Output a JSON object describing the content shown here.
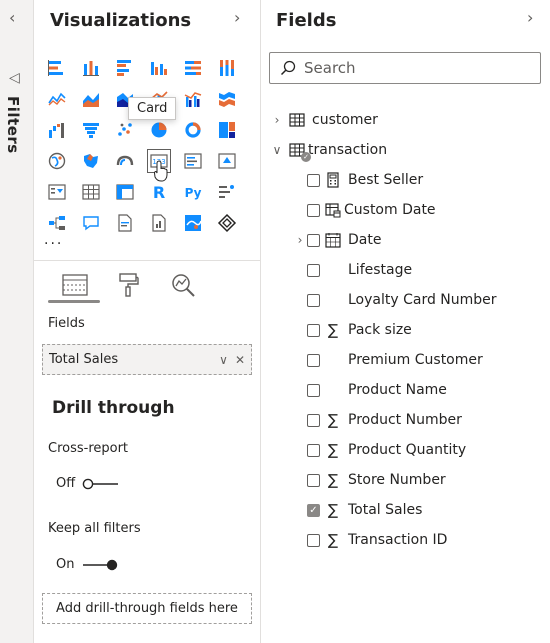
{
  "filters": {
    "label": "Filters",
    "collapse_icon": "chevron-left-icon",
    "icon": "funnel-icon"
  },
  "visualizations": {
    "title": "Visualizations",
    "expand_icon": "chevron-right-icon",
    "tooltip": "Card",
    "more": "...",
    "subtab_icons": [
      "build-visual-icon",
      "format-paintbrush-icon",
      "analytics-magnifier-icon"
    ],
    "fields_label": "Fields",
    "well_field": "Total Sales",
    "drill_title": "Drill through",
    "cross_report_label": "Cross-report",
    "cross_report_state": "Off",
    "keep_filters_label": "Keep all filters",
    "keep_filters_state": "On",
    "add_drill_label": "Add drill-through fields here"
  },
  "fields_pane": {
    "title": "Fields",
    "expand_icon": "chevron-right-icon",
    "search_placeholder": "Search",
    "tables": [
      {
        "name": "customer",
        "expanded": false
      },
      {
        "name": "transaction",
        "expanded": true
      }
    ],
    "items": [
      {
        "name": "Best Seller",
        "icon": "calculator-icon",
        "checked": false,
        "expandable": false
      },
      {
        "name": "Custom Date",
        "icon": "date-table-icon",
        "checked": false,
        "expandable": false
      },
      {
        "name": "Date",
        "icon": "calendar-icon",
        "checked": false,
        "expandable": true
      },
      {
        "name": "Lifestage",
        "icon": "",
        "checked": false,
        "expandable": false
      },
      {
        "name": "Loyalty Card Number",
        "icon": "",
        "checked": false,
        "expandable": false
      },
      {
        "name": "Pack size",
        "icon": "sigma-icon",
        "checked": false,
        "expandable": false
      },
      {
        "name": "Premium Customer",
        "icon": "",
        "checked": false,
        "expandable": false
      },
      {
        "name": "Product Name",
        "icon": "",
        "checked": false,
        "expandable": false
      },
      {
        "name": "Product Number",
        "icon": "sigma-icon",
        "checked": false,
        "expandable": false
      },
      {
        "name": "Product Quantity",
        "icon": "sigma-icon",
        "checked": false,
        "expandable": false
      },
      {
        "name": "Store Number",
        "icon": "sigma-icon",
        "checked": false,
        "expandable": false
      },
      {
        "name": "Total Sales",
        "icon": "sigma-icon",
        "checked": true,
        "expandable": false
      },
      {
        "name": "Transaction ID",
        "icon": "sigma-icon",
        "checked": false,
        "expandable": false
      }
    ]
  },
  "colors": {
    "accent_blue": "#118dff",
    "accent_orange": "#e66c37",
    "accent_gray": "#605e5c"
  }
}
